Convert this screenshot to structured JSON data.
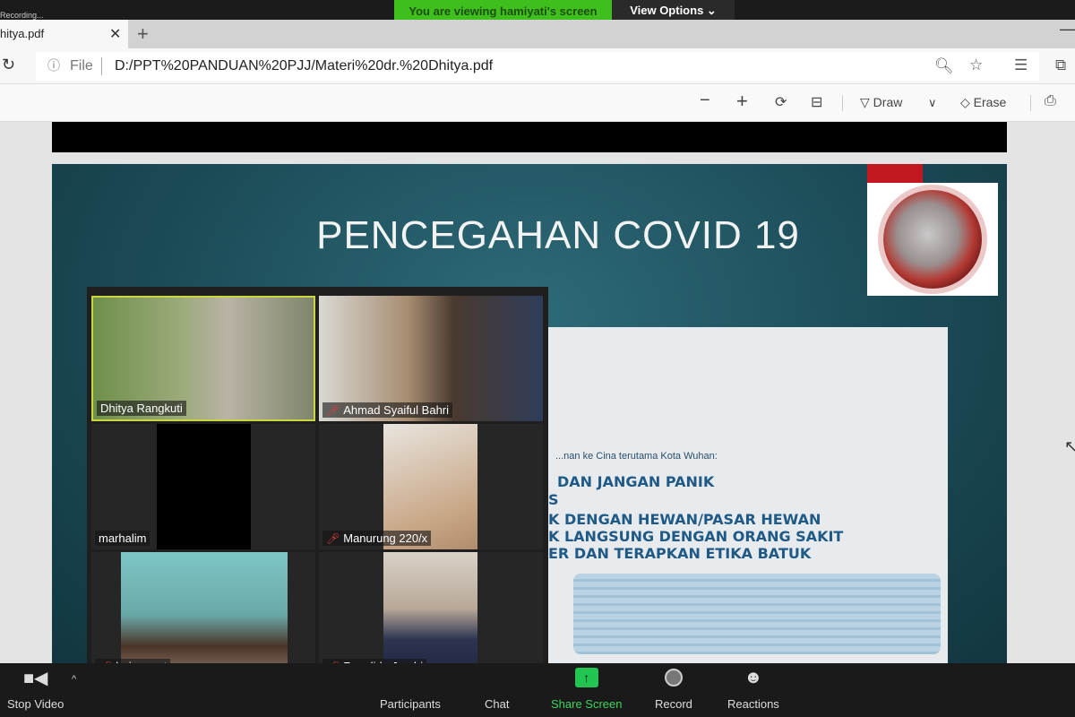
{
  "zoom": {
    "banner": "You are viewing hamiyati's screen",
    "view_options": "View Options ⌄",
    "recording": "Recording...",
    "share_color": "#3fbf1e"
  },
  "browser": {
    "tab_title": "hitya.pdf",
    "file_label": "File",
    "url": "D:/PPT%20PANDUAN%20PJJ/Materi%20dr.%20Dhitya.pdf"
  },
  "pdf_toolbar": {
    "draw": "Draw",
    "erase": "Erase"
  },
  "slide": {
    "title": "PENCEGAHAN COVID 19",
    "subtitle": "...nan ke Cina terutama Kota Wuhan:",
    "lines": [
      "DAN JANGAN PANIK",
      "S",
      "K DENGAN HEWAN/PASAR HEWAN",
      "K LANGSUNG DENGAN ORANG SAKIT",
      "ER DAN TERAPKAN ETIKA BATUK"
    ]
  },
  "participants": [
    {
      "name": "Dhitya Rangkuti",
      "muted": false,
      "active": true
    },
    {
      "name": "Ahmad Syaiful Bahri",
      "muted": true
    },
    {
      "name": "marhalim",
      "muted": false
    },
    {
      "name": "Manurung 220/x",
      "muted": true
    },
    {
      "name": "hoiron nst",
      "muted": true
    },
    {
      "name": "Revolida Jambi",
      "muted": true
    }
  ],
  "controls": {
    "stop_video": "Stop Video",
    "participants": "Participants",
    "chat": "Chat",
    "share_screen": "Share Screen",
    "record": "Record",
    "reactions": "Reactions"
  }
}
